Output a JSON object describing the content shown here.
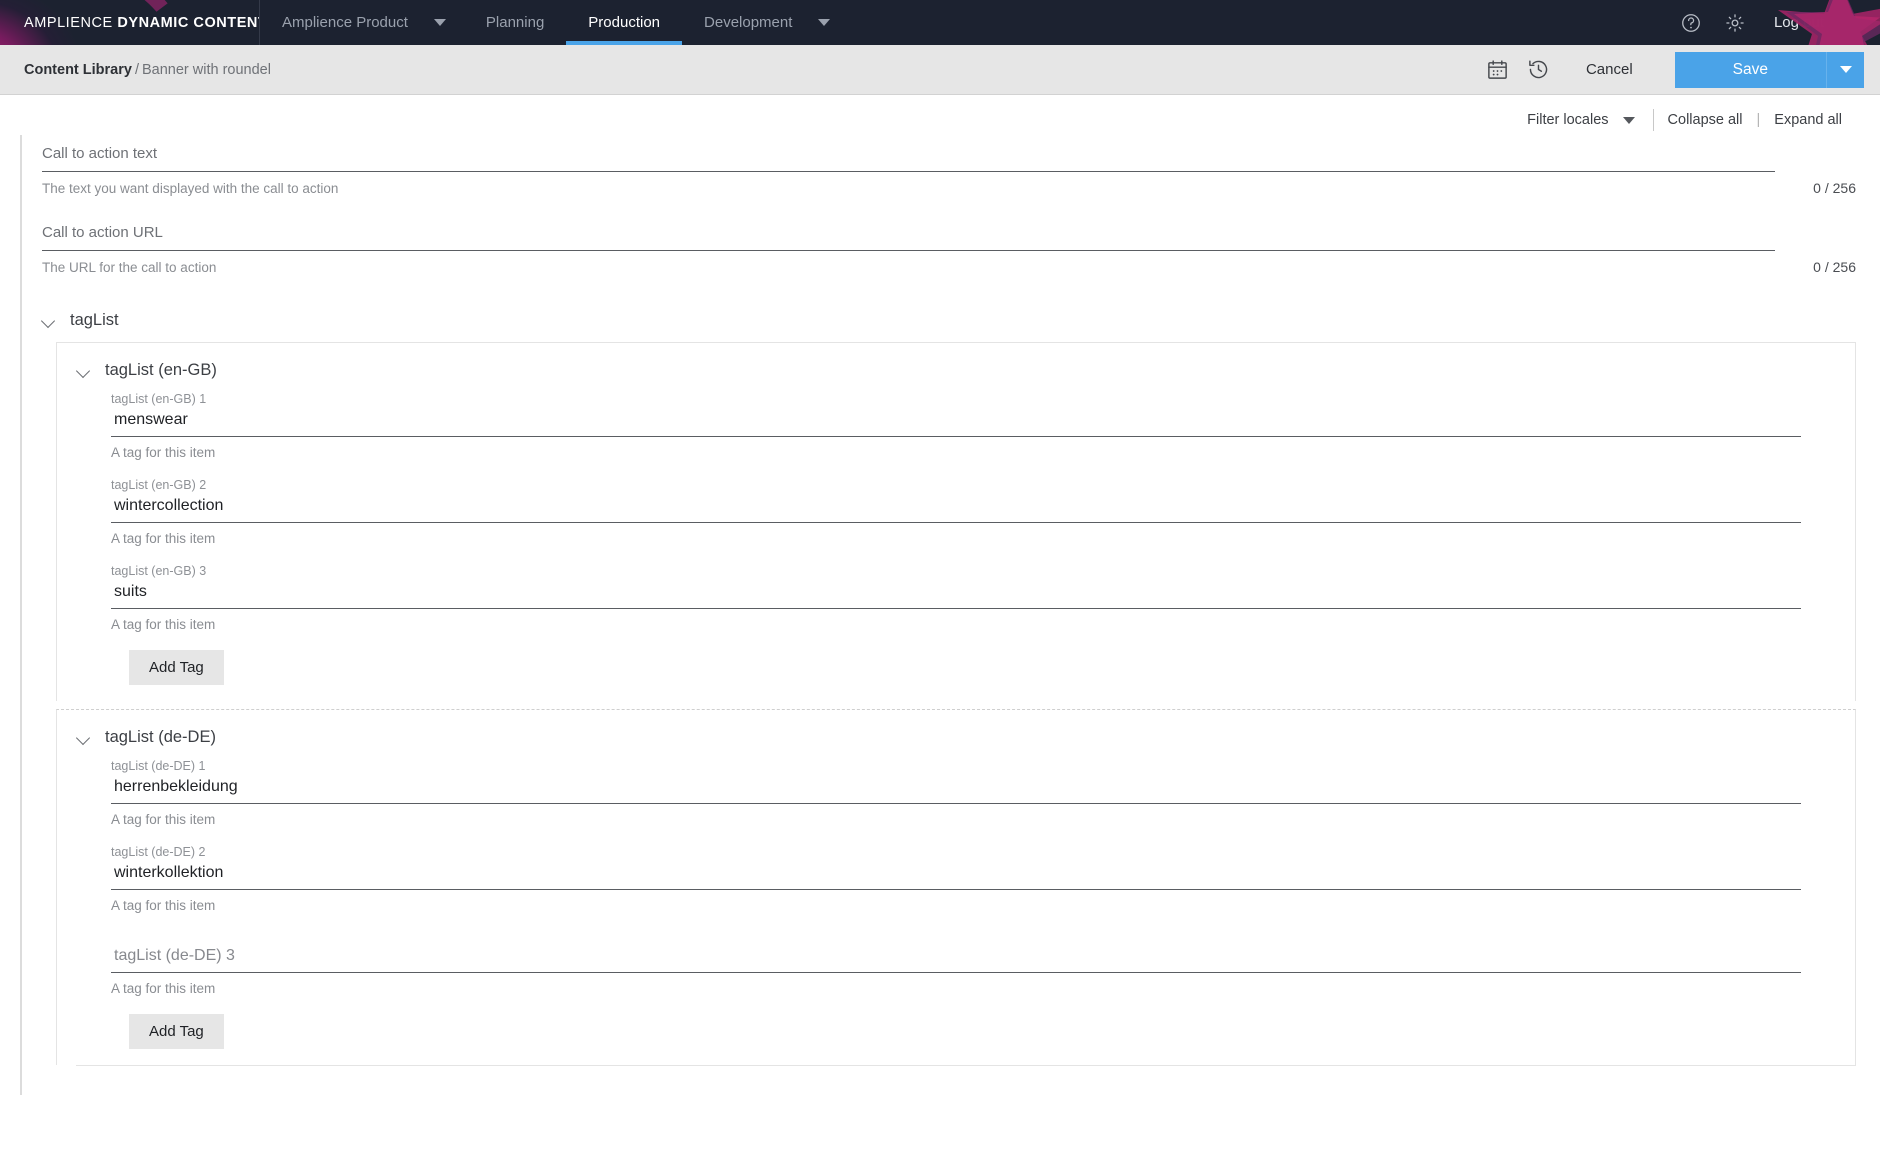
{
  "topnav": {
    "brand_thin": "AMPLIENCE ",
    "brand_bold": "DYNAMIC CONTENT",
    "product_label": "Amplience Product",
    "tabs": [
      {
        "label": "Planning",
        "active": false
      },
      {
        "label": "Production",
        "active": true
      },
      {
        "label": "Development",
        "active": false
      }
    ],
    "help_icon": "help-circle-icon",
    "settings_icon": "gear-icon",
    "logout_label": "Log out"
  },
  "actionbar": {
    "breadcrumb_root": "Content Library",
    "breadcrumb_sep": "/",
    "breadcrumb_current": "Banner with roundel",
    "calendar_icon": "calendar-icon",
    "history_icon": "history-clock-icon",
    "cancel_label": "Cancel",
    "save_label": "Save",
    "save_caret_icon": "chevron-down-icon",
    "accent_color": "#4aa3e8"
  },
  "locale_toolbar": {
    "filter_label": "Filter locales",
    "filter_caret_icon": "chevron-down-icon",
    "collapse_all": "Collapse all",
    "pipe": "|",
    "expand_all": "Expand all"
  },
  "fields": [
    {
      "label": "Call to action text",
      "value": "",
      "hint": "The text you want displayed with the call to action",
      "counter": "0 / 256"
    },
    {
      "label": "Call to action URL",
      "value": "",
      "hint": "The URL for the call to action",
      "counter": "0 / 256"
    }
  ],
  "taglist": {
    "section_title": "tagList",
    "locales": [
      {
        "title": "tagList (en-GB)",
        "add_label": "Add Tag",
        "items": [
          {
            "caption": "tagList (en-GB) 1",
            "value": "menswear",
            "hint": "A tag for this item",
            "empty": false
          },
          {
            "caption": "tagList (en-GB) 2",
            "value": "wintercollection",
            "hint": "A tag for this item",
            "empty": false
          },
          {
            "caption": "tagList (en-GB) 3",
            "value": "suits",
            "hint": "A tag for this item",
            "empty": false
          }
        ]
      },
      {
        "title": "tagList (de-DE)",
        "add_label": "Add Tag",
        "items": [
          {
            "caption": "tagList (de-DE) 1",
            "value": "herrenbekleidung",
            "hint": "A tag for this item",
            "empty": false
          },
          {
            "caption": "tagList (de-DE) 2",
            "value": "winterkollektion",
            "hint": "A tag for this item",
            "empty": false
          },
          {
            "caption": "tagList (de-DE) 3",
            "value": "",
            "hint": "A tag for this item",
            "empty": true
          }
        ]
      }
    ]
  }
}
